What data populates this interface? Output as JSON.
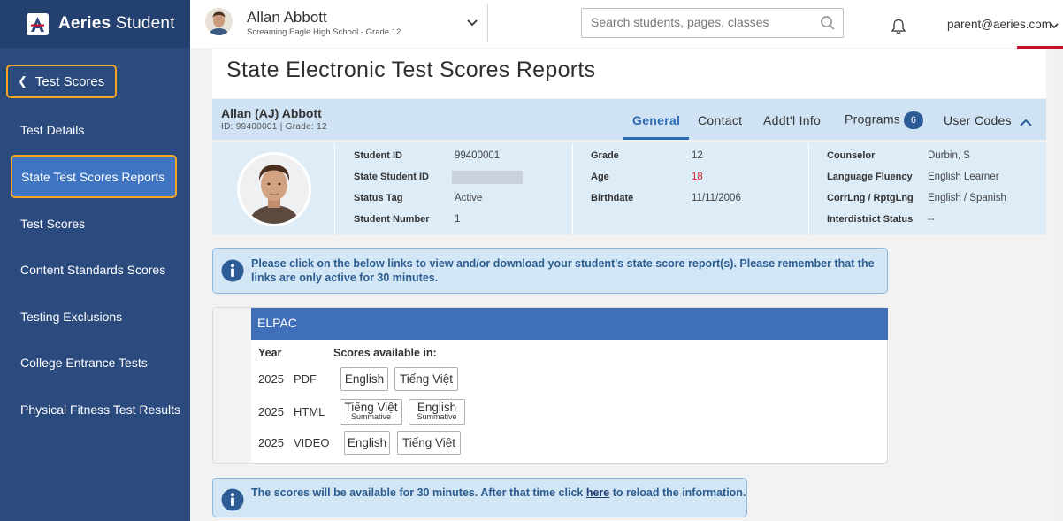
{
  "app": {
    "brand_bold": "Aeries",
    "brand_light": "Student"
  },
  "sidebar": {
    "back_label": "Test Scores",
    "items": [
      {
        "label": "Test Details"
      },
      {
        "label": "State Test Scores Reports"
      },
      {
        "label": "Test Scores"
      },
      {
        "label": "Content Standards Scores"
      },
      {
        "label": "Testing Exclusions"
      },
      {
        "label": "College Entrance Tests"
      },
      {
        "label": "Physical Fitness Test Results"
      }
    ]
  },
  "topbar": {
    "student_name": "Allan Abbott",
    "student_school": "Screaming Eagle High School - Grade 12",
    "search_placeholder": "Search students, pages, classes",
    "user_email": "parent@aeries.com"
  },
  "page": {
    "title": "State Electronic Test Scores Reports"
  },
  "student": {
    "display_name": "Allan (AJ) Abbott",
    "id_line": "ID: 99400001 |  Grade: 12",
    "tabs": [
      {
        "label": "General"
      },
      {
        "label": "Contact"
      },
      {
        "label": "Addt'l Info"
      },
      {
        "label": "Programs",
        "badge": "6"
      },
      {
        "label": "User Codes"
      }
    ],
    "col1": [
      {
        "label": "Student ID",
        "value": "99400001"
      },
      {
        "label": "State Student ID",
        "value": ""
      },
      {
        "label": "Status Tag",
        "value": "Active"
      },
      {
        "label": "Student Number",
        "value": "1"
      }
    ],
    "col2": [
      {
        "label": "Grade",
        "value": "12"
      },
      {
        "label": "Age",
        "value": "18"
      },
      {
        "label": "Birthdate",
        "value": "11/11/2006"
      }
    ],
    "col3": [
      {
        "label": "Counselor",
        "value": "Durbin, S"
      },
      {
        "label": "Language Fluency",
        "value": "English Learner"
      },
      {
        "label": "CorrLng / RptgLng",
        "value": "English / Spanish"
      },
      {
        "label": "Interdistrict Status",
        "value": "--"
      }
    ]
  },
  "notice1": "Please click on the below links to view and/or download your student's state score report(s). Please remember that the links are only active for 30 minutes.",
  "elpac": {
    "title": "ELPAC",
    "col_year": "Year",
    "col_scores": "Scores available in:",
    "rows": [
      {
        "year": "2025",
        "format": "PDF",
        "buttons": [
          {
            "label": "English"
          },
          {
            "label": "Tiếng Việt"
          }
        ]
      },
      {
        "year": "2025",
        "format": "HTML",
        "buttons": [
          {
            "label": "Tiếng Việt",
            "sub": "Summative"
          },
          {
            "label": "English",
            "sub": "Summative"
          }
        ]
      },
      {
        "year": "2025",
        "format": "VIDEO",
        "buttons": [
          {
            "label": "English"
          },
          {
            "label": "Tiếng Việt"
          }
        ]
      }
    ]
  },
  "notice2": {
    "before": "The scores will be available for 30 minutes. After that time click ",
    "link": "here",
    "after": " to reload the information."
  },
  "colors": {
    "sidebar": "#2b4a7e",
    "accent": "#3f74c0",
    "highlight": "#f5a623",
    "age_red": "#d12424"
  }
}
